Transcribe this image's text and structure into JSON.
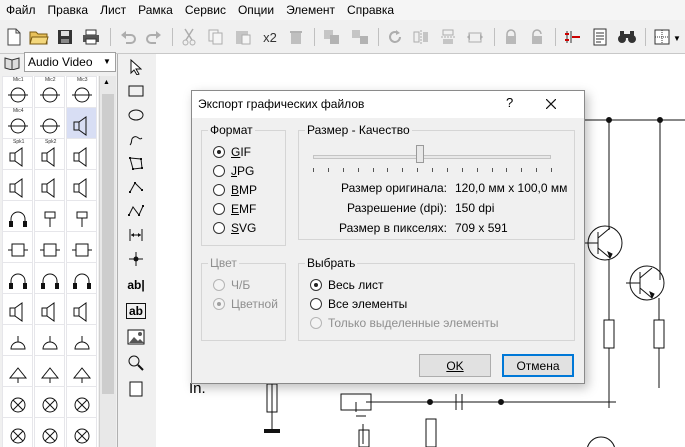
{
  "menu": [
    "Файл",
    "Правка",
    "Лист",
    "Рамка",
    "Сервис",
    "Опции",
    "Элемент",
    "Справка"
  ],
  "toolbar": {
    "copies_label": "x2",
    "icons": [
      "new-file-icon",
      "open-folder-icon",
      "save-icon",
      "print-icon",
      "undo-icon",
      "redo-icon",
      "cut-icon",
      "copy-icon",
      "paste-icon",
      "duplicate-icon",
      "delete-icon",
      "group-icon",
      "ungroup-icon",
      "rotate-icon",
      "mirror-horizontal-icon",
      "mirror-vertical-icon",
      "flip-icon",
      "lock-icon",
      "unlock-icon",
      "netlist-icon",
      "properties-icon",
      "search-icon",
      "grid-icon"
    ]
  },
  "library": {
    "selected": "Audio Video",
    "selected_cell": 5,
    "cell_labels": [
      "Mic1",
      "Mic2",
      "Mic3",
      "Mic4",
      "",
      "",
      "Spk1",
      "Spk2",
      "",
      "",
      "",
      "",
      "",
      "",
      "",
      "",
      "",
      "",
      "",
      "",
      "",
      "",
      "",
      "",
      "",
      "",
      "",
      "",
      "",
      "",
      "",
      "",
      "",
      "",
      "",
      "",
      "",
      ""
    ],
    "cell_icons": [
      "microphone-symbol-icon",
      "microphone-symbol-icon",
      "microphone-symbol-icon",
      "microphone-symbol-icon",
      "microphone-symbol-icon",
      "speaker-symbol-icon",
      "speaker-symbol-icon",
      "speaker-symbol-icon",
      "speaker-symbol-icon",
      "speaker-symbol-icon",
      "speaker-symbol-icon",
      "speaker-symbol-icon",
      "headphone-symbol-icon",
      "earphone-symbol-icon",
      "earphone-symbol-icon",
      "jack-symbol-icon",
      "jack-symbol-icon",
      "jack-symbol-icon",
      "headphone-symbol-icon",
      "headphone-symbol-icon",
      "headphone-symbol-icon",
      "speaker-symbol-icon",
      "speaker-symbol-icon",
      "speaker-symbol-icon",
      "bell-symbol-icon",
      "bell-symbol-icon",
      "bell-symbol-icon",
      "buzzer-symbol-icon",
      "buzzer-symbol-icon",
      "buzzer-symbol-icon",
      "lamp-symbol-icon",
      "lamp-symbol-icon",
      "lamp-symbol-icon",
      "lamp-symbol-icon",
      "lamp-symbol-icon",
      "lamp-symbol-icon"
    ]
  },
  "tools": [
    "select-arrow-icon",
    "rectangle-icon",
    "ellipse-icon",
    "freehand-icon",
    "polygon-icon",
    "polyline-icon",
    "bezier-icon",
    "dimension-icon",
    "junction-icon",
    "text-icon",
    "text-box-icon",
    "image-icon",
    "zoom-icon",
    "page-icon"
  ],
  "tool_labels": {
    "text": "ab|",
    "textbox": "ab"
  },
  "canvas": {
    "text": "In."
  },
  "dialog": {
    "title": "Экспорт графических файлов",
    "help": "?",
    "format": {
      "title": "Формат",
      "options": [
        {
          "pre": "",
          "u": "G",
          "post": "IF",
          "selected": true
        },
        {
          "pre": "",
          "u": "J",
          "post": "PG",
          "selected": false
        },
        {
          "pre": "",
          "u": "B",
          "post": "MP",
          "selected": false
        },
        {
          "pre": "",
          "u": "E",
          "post": "MF",
          "selected": false
        },
        {
          "pre": "",
          "u": "S",
          "post": "VG",
          "selected": false
        }
      ]
    },
    "quality": {
      "title": "Размер - Качество",
      "slider_value": 0.45,
      "tick_count": 17,
      "rows": [
        {
          "label": "Размер оригинала:",
          "value": "120,0 мм x 100,0 мм"
        },
        {
          "label": "Разрешение (dpi):",
          "value": "150 dpi"
        },
        {
          "label": "Размер в пикселях:",
          "value": "709 x 591"
        }
      ]
    },
    "color": {
      "title": "Цвет",
      "options": [
        {
          "label": "Ч/Б",
          "selected": false
        },
        {
          "label": "Цветной",
          "selected": true
        }
      ]
    },
    "select": {
      "title": "Выбрать",
      "options": [
        {
          "label": "Весь лист",
          "selected": true,
          "disabled": false
        },
        {
          "label": "Все элементы",
          "selected": false,
          "disabled": false
        },
        {
          "label": "Только выделенные элементы",
          "selected": false,
          "disabled": true
        }
      ]
    },
    "ok_label": "OK",
    "cancel_label": "Отмена"
  }
}
